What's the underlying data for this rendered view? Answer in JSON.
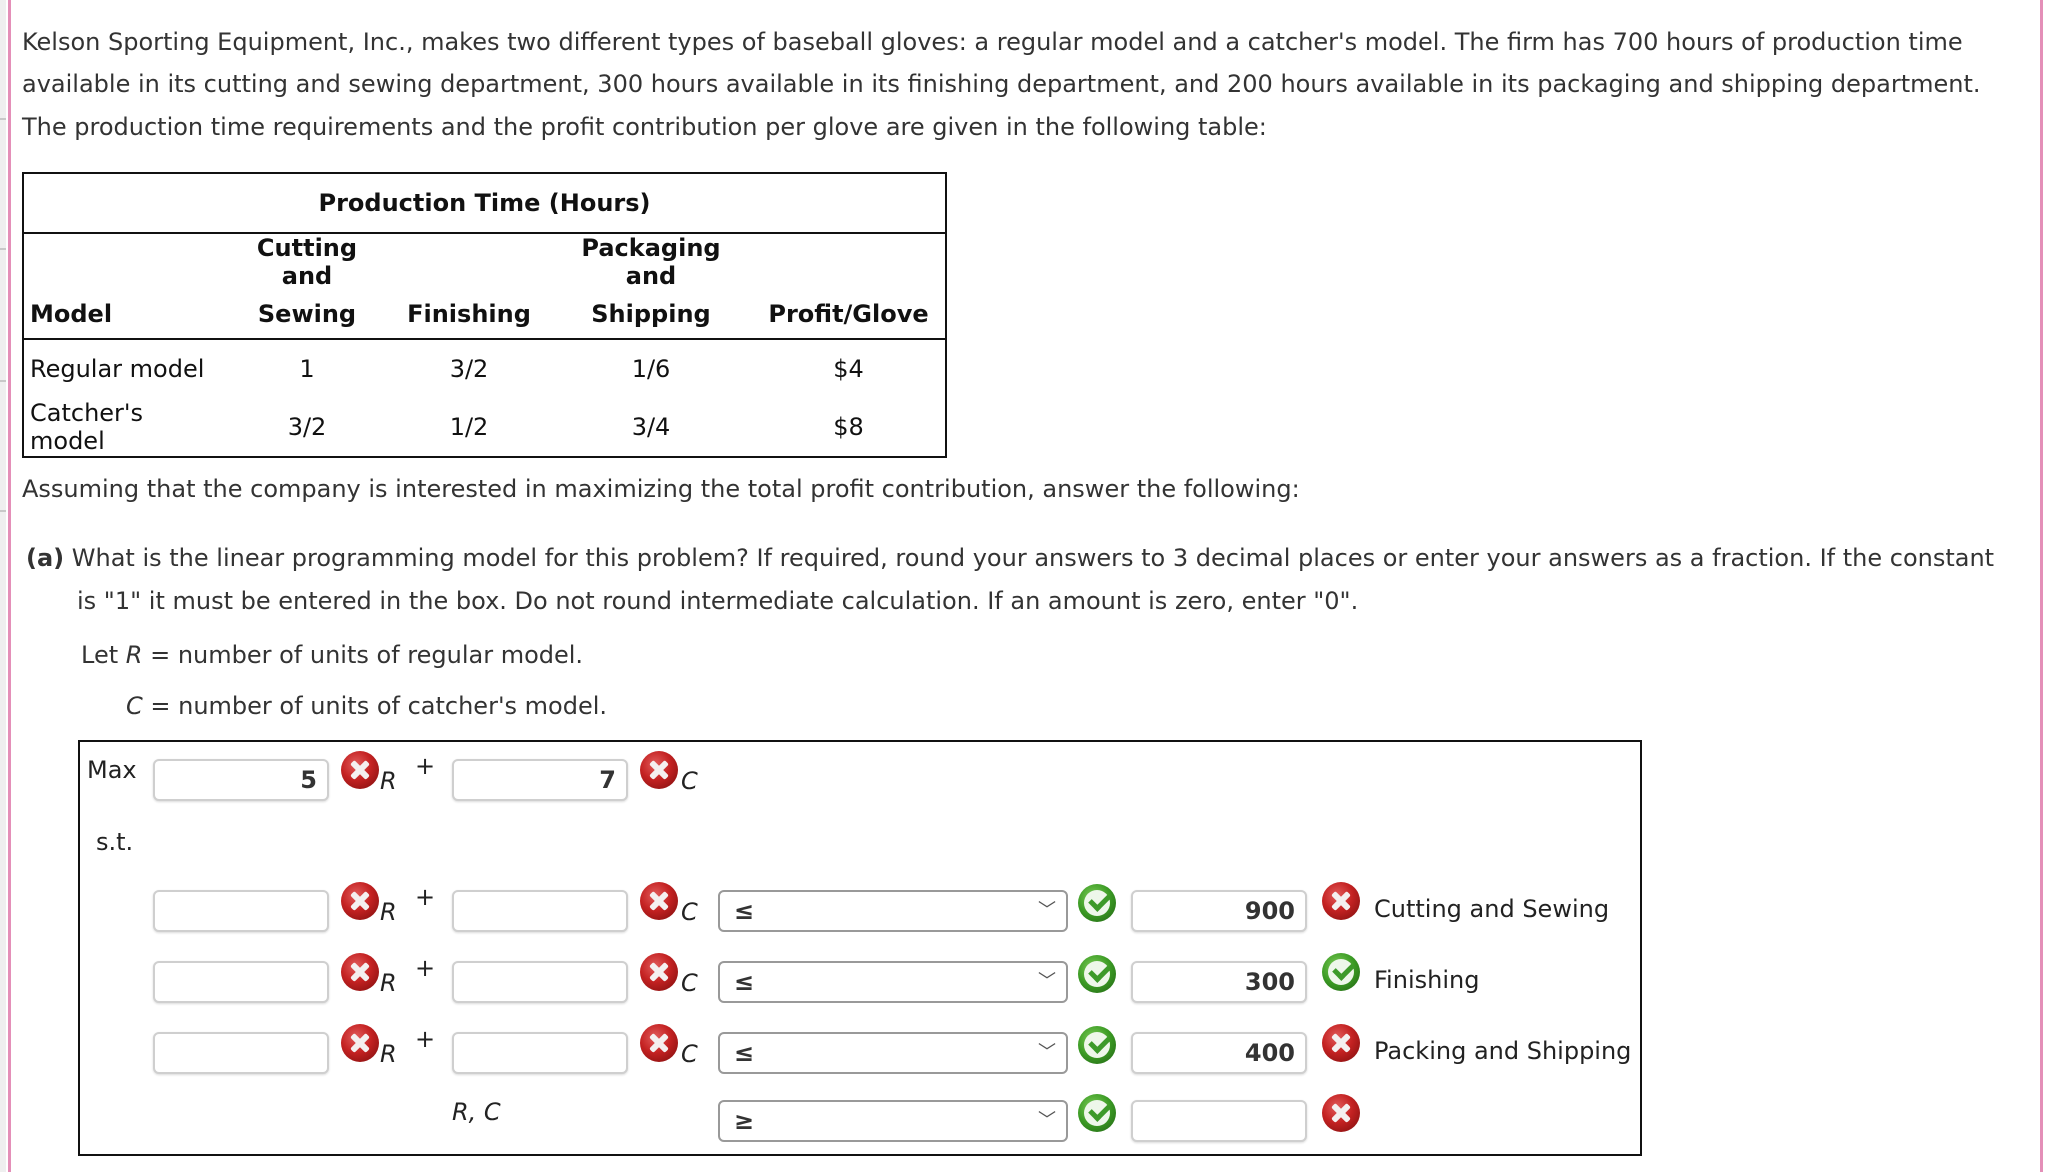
{
  "intro": {
    "line1": "Kelson Sporting Equipment, Inc., makes two different types of baseball gloves: a regular model and a catcher's model. The firm has 700 hours of production time",
    "line2": "available in its cutting and sewing department, 300 hours available in its finishing department, and 200 hours available in its packaging and shipping department.",
    "line3": "The production time requirements and the profit contribution per glove are given in the following table:"
  },
  "table": {
    "title": "Production Time (Hours)",
    "headers_top": [
      "",
      "Cutting and",
      "",
      "Packaging and",
      ""
    ],
    "headers_bottom": [
      "Model",
      "Sewing",
      "Finishing",
      "Shipping",
      "Profit/Glove"
    ],
    "rows": [
      [
        "Regular model",
        "1",
        "3/2",
        "1/6",
        "$4"
      ],
      [
        "Catcher's model",
        "3/2",
        "1/2",
        "3/4",
        "$8"
      ]
    ]
  },
  "assumption": "Assuming that the company is interested in maximizing the total profit contribution, answer the following:",
  "question_a": {
    "label": "(a)",
    "line1": "What is the linear programming model for this problem? If required, round your answers to 3 decimal places or enter your answers as a fraction. If the constant",
    "line2": "is \"1\" it must be entered in the box. Do not round intermediate calculation. If an amount is zero, enter \"0\".",
    "let_r_prefix": "Let ",
    "let_r_var": "R",
    "let_r_suffix": " = number of units of regular model.",
    "let_c_var": "C",
    "let_c_suffix": " = number of units of catcher's model."
  },
  "model": {
    "max_label": "Max",
    "st_label": "s.t.",
    "plus": "+",
    "var_r": "R",
    "var_c": "C",
    "objective": {
      "r_coef": "5",
      "r_status": "incorrect",
      "c_coef": "7",
      "c_status": "incorrect"
    },
    "constraints": [
      {
        "r_coef": "",
        "r_status": "incorrect",
        "c_coef": "",
        "c_status": "incorrect",
        "sign": "≤",
        "sign_status": "correct",
        "rhs": "900",
        "rhs_status": "incorrect",
        "name": "Cutting and Sewing"
      },
      {
        "r_coef": "",
        "r_status": "incorrect",
        "c_coef": "",
        "c_status": "incorrect",
        "sign": "≤",
        "sign_status": "correct",
        "rhs": "300",
        "rhs_status": "correct",
        "name": "Finishing"
      },
      {
        "r_coef": "",
        "r_status": "incorrect",
        "c_coef": "",
        "c_status": "incorrect",
        "sign": "≤",
        "sign_status": "correct",
        "rhs": "400",
        "rhs_status": "incorrect",
        "name": "Packing and Shipping"
      }
    ],
    "nonneg": {
      "vars": "R, C",
      "sign": "≥",
      "sign_status": "correct",
      "rhs": "",
      "rhs_status": "incorrect"
    }
  },
  "icons": {
    "incorrect": "x-circle-icon",
    "correct": "check-circle-icon",
    "dropdown": "chevron-down-icon"
  },
  "colors": {
    "incorrect": "#c42222",
    "correct": "#3b9a24",
    "accent_border": "#e48fb8"
  }
}
